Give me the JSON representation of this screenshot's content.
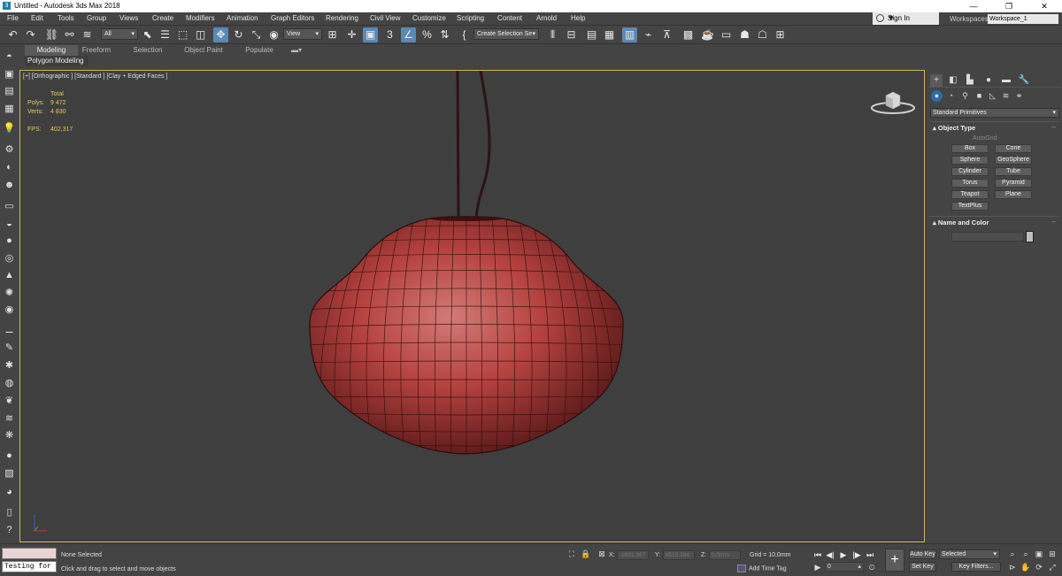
{
  "window": {
    "title": "Untitled - Autodesk 3ds Max 2018",
    "minimize": "—",
    "restore": "❐",
    "close": "✕"
  },
  "menu": [
    "File",
    "Edit",
    "Tools",
    "Group",
    "Views",
    "Create",
    "Modifiers",
    "Animation",
    "Graph Editors",
    "Rendering",
    "Civil View",
    "Customize",
    "Scripting",
    "Content",
    "Arnold",
    "Help"
  ],
  "account": {
    "sign_in": "Sign In",
    "workspaces_label": "Workspaces:",
    "workspace": "Workspace_1"
  },
  "toolbar": {
    "selection_filter": "All",
    "ref_coord": "View",
    "snap_label": "3",
    "named_selection": "Create Selection Se",
    "icons": [
      "undo-icon",
      "redo-icon",
      "link-icon",
      "unlink-icon",
      "bind-space-warp-icon",
      "select-object-icon",
      "select-by-name-icon",
      "rect-selection-icon",
      "window-crossing-icon",
      "select-move-icon",
      "select-rotate-icon",
      "select-scale-icon",
      "select-place-icon",
      "use-pivot-icon",
      "select-manipulate-icon",
      "keyboard-shortcut-icon",
      "snaps-toggle-icon",
      "angle-snap-icon",
      "percent-snap-icon",
      "spinner-snap-icon",
      "edit-named-sets-icon",
      "mirror-icon",
      "align-icon",
      "scene-explorer-icon",
      "layer-explorer-icon",
      "toggle-ribbon-icon",
      "curve-editor-icon",
      "schematic-view-icon",
      "material-editor-icon",
      "render-setup-icon",
      "rendered-frame-icon",
      "render-production-icon",
      "render-iterative-icon",
      "render-cloud-icon"
    ]
  },
  "ribbon": {
    "tabs": [
      "Modeling",
      "Freeform",
      "Selection",
      "Object Paint",
      "Populate"
    ],
    "active_tab": "Modeling",
    "sub_label": "Polygon Modeling"
  },
  "viewport": {
    "label": "[+] [Orthographic ] [Standard ] [Clay + Edged Faces ]",
    "stats": {
      "header": "Total",
      "polys_label": "Polys:",
      "polys": "9 472",
      "verts_label": "Verts:",
      "verts": "4 830",
      "fps_label": "FPS:",
      "fps": "402,317"
    },
    "lamp_color": "#b4423f",
    "border_color": "#c9b55a"
  },
  "command_panel": {
    "category": "Standard Primitives",
    "object_type_title": "Object Type",
    "autogrid": "AutoGrid",
    "buttons": [
      "Box",
      "Cone",
      "Sphere",
      "GeoSphere",
      "Cylinder",
      "Tube",
      "Torus",
      "Pyramid",
      "Teapot",
      "Plane",
      "TextPlus"
    ],
    "name_and_color_title": "Name and Color",
    "rollout_sign": "–",
    "collapse_sign": "▴"
  },
  "status": {
    "maxscript_input": "Testing for :",
    "selection": "None Selected",
    "prompt": "Click and drag to select and move objects",
    "x_label": "X:",
    "x_value": "-2681,367",
    "y_label": "Y:",
    "y_value": "8515,284",
    "z_label": "Z:",
    "z_value": "0,0mm",
    "grid": "Grid = 10,0mm",
    "add_time_tag": "Add Time Tag",
    "frame": "0",
    "auto_key": "Auto Key",
    "set_key": "Set Key",
    "key_mode": "Selected",
    "key_filters": "Key Filters..."
  }
}
